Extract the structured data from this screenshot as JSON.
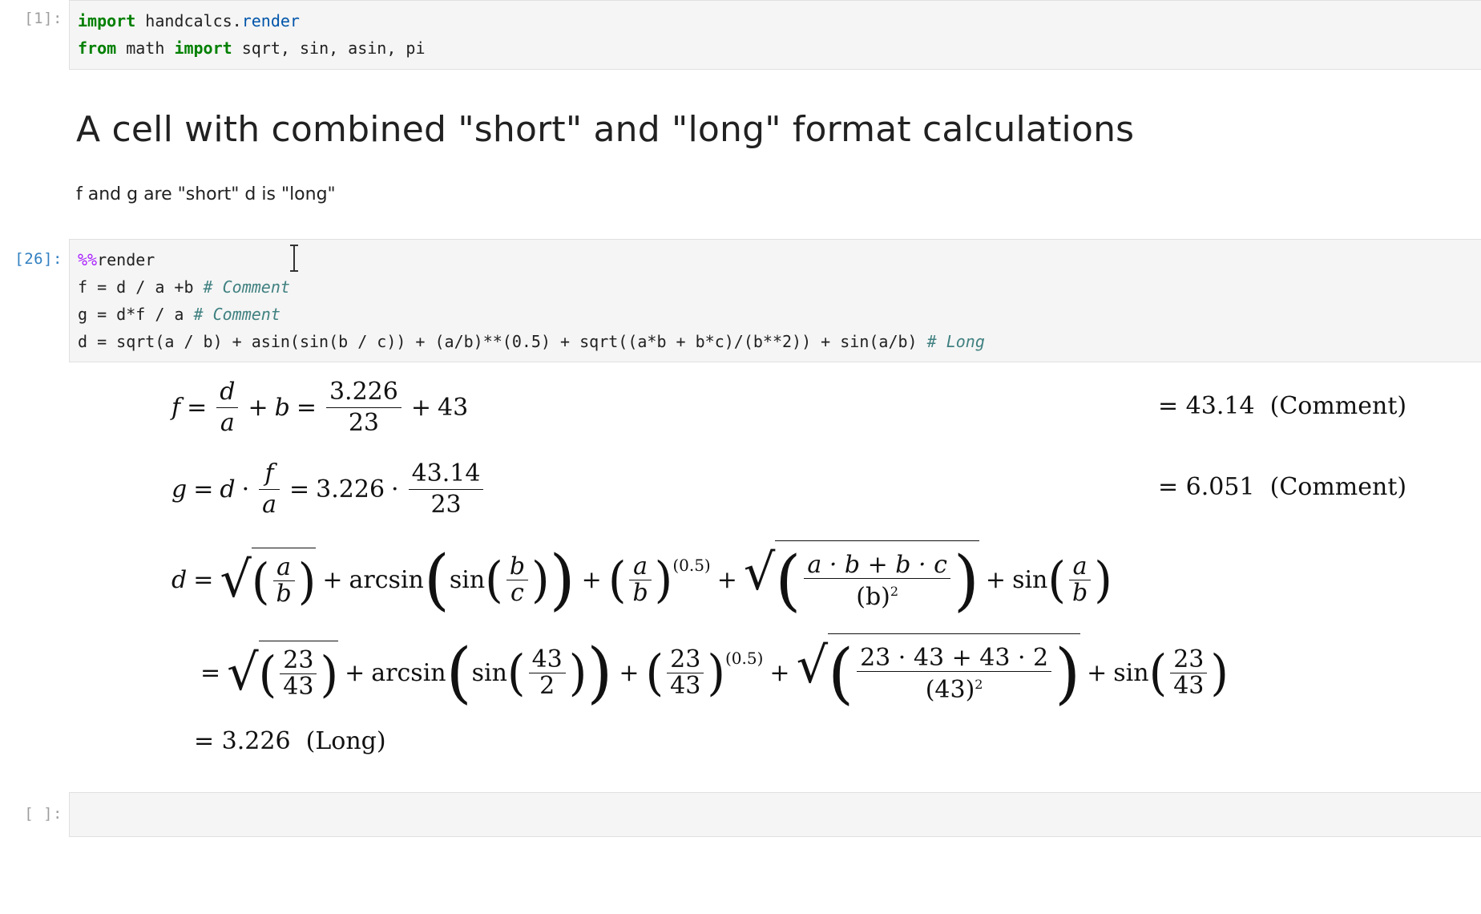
{
  "cells": {
    "cell1": {
      "prompt": "[1]:",
      "line1": {
        "kw": "import",
        "mod_a": "handcalcs.",
        "mod_b": "render"
      },
      "line2": {
        "kw1": "from",
        "mid": "math",
        "kw2": "import",
        "rest": "sqrt, sin, asin, pi"
      }
    },
    "markdown": {
      "heading": "A cell with combined \"short\" and \"long\" format calculations",
      "paragraph": "f and g are \"short\" d is \"long\""
    },
    "cell2": {
      "prompt": "[26]:",
      "magic_a": "%%",
      "magic_b": "render",
      "line_f": "f = d / a +b",
      "line_f_comment": "# Comment",
      "line_g": "g = d*f / a",
      "line_g_comment": "# Comment",
      "line_d": "d = sqrt(a / b) + asin(sin(b / c)) + (a/b)**(0.5) + sqrt((a*b + b*c)/(b**2)) + sin(a/b)",
      "line_d_comment": "# Long"
    },
    "cell3": {
      "prompt": "[ ]:"
    }
  },
  "output": {
    "f": {
      "lhs": "f",
      "sym_num": "d",
      "sym_den": "a",
      "plus_b": "b",
      "val_num": "3.226",
      "val_den": "23",
      "val_plus": "43",
      "result": "= 43.14",
      "comment": "(Comment)"
    },
    "g": {
      "lhs": "g",
      "d": "d",
      "f_num": "f",
      "f_den": "a",
      "val_d": "3.226",
      "val_num": "43.14",
      "val_den": "23",
      "result": "= 6.051",
      "comment": "(Comment)"
    },
    "d": {
      "lhs": "d",
      "a": "a",
      "b": "b",
      "c": "c",
      "arcsin": "arcsin",
      "sin": "sin",
      "exp": "(0.5)",
      "ab_bc": "a · b + b · c",
      "b_sq": "(b)",
      "sq": "2",
      "n23": "23",
      "n43": "43",
      "n2": "2",
      "num_sub": "23 · 43 + 43 · 2",
      "den_sub": "(43)",
      "result": "= 3.226",
      "comment": "(Long)"
    }
  }
}
